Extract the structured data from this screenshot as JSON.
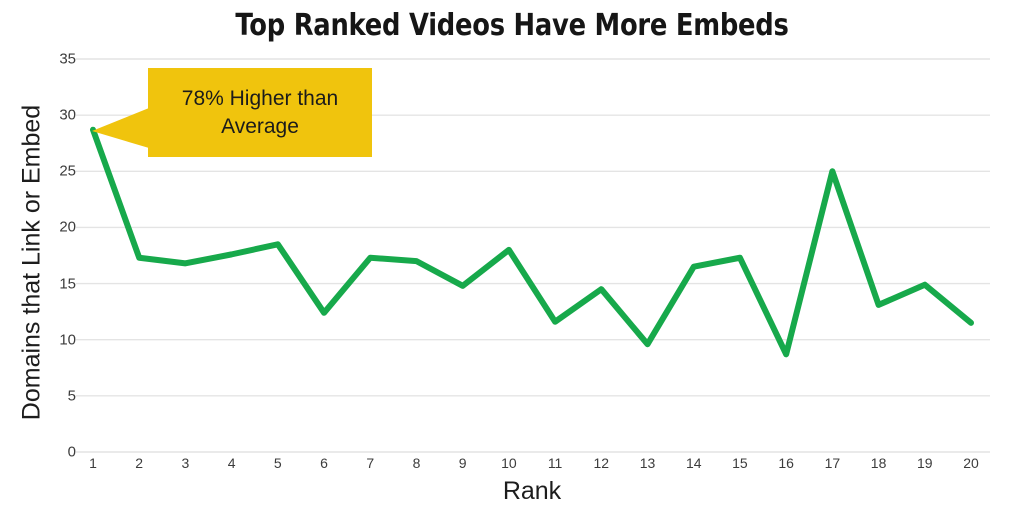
{
  "chart_data": {
    "type": "line",
    "title": "Top Ranked Videos Have More Embeds",
    "xlabel": "Rank",
    "ylabel": "Domains that Link or Embed",
    "categories": [
      1,
      2,
      3,
      4,
      5,
      6,
      7,
      8,
      9,
      10,
      11,
      12,
      13,
      14,
      15,
      16,
      17,
      18,
      19,
      20
    ],
    "x_tick_labels": [
      "1",
      "2",
      "3",
      "4",
      "5",
      "6",
      "7",
      "8",
      "9",
      "10",
      "11",
      "12",
      "13",
      "14",
      "15",
      "16",
      "17",
      "18",
      "19",
      "20"
    ],
    "values": [
      28.7,
      17.3,
      16.8,
      17.6,
      18.5,
      12.4,
      17.3,
      17.0,
      14.8,
      18.0,
      11.6,
      14.5,
      9.6,
      16.5,
      17.3,
      8.7,
      25.0,
      13.1,
      14.9,
      11.5
    ],
    "series": [
      {
        "name": "Domains that Link or Embed",
        "color": "#17A94B",
        "values": [
          28.7,
          17.3,
          16.8,
          17.6,
          18.5,
          12.4,
          17.3,
          17.0,
          14.8,
          18.0,
          11.6,
          14.5,
          9.6,
          16.5,
          17.3,
          8.7,
          25.0,
          13.1,
          14.9,
          11.5
        ]
      }
    ],
    "ylim": [
      0,
      35
    ],
    "xlim": [
      1,
      20
    ],
    "y_ticks": [
      0,
      5,
      10,
      15,
      20,
      25,
      30,
      35
    ],
    "y_tick_labels": [
      "0",
      "5",
      "10",
      "15",
      "20",
      "25",
      "30",
      "35"
    ],
    "grid": true,
    "grid_axis": "y",
    "legend": false,
    "legend_position": "none",
    "annotations": [
      {
        "text": "78% Higher than\nAverage",
        "target_rank": 1,
        "target_value": 28.7,
        "background_color": "#F0C40D",
        "text_color": "#1b1b1b"
      }
    ],
    "colors": {
      "line": "#17A94B",
      "gridline": "#E4E4E4",
      "annotation_background": "#F0C40D",
      "title_text": "#161616",
      "axis_text": "#3c3c3c",
      "axis_title_text": "#1d1d1d",
      "background": "#FFFFFF"
    }
  }
}
